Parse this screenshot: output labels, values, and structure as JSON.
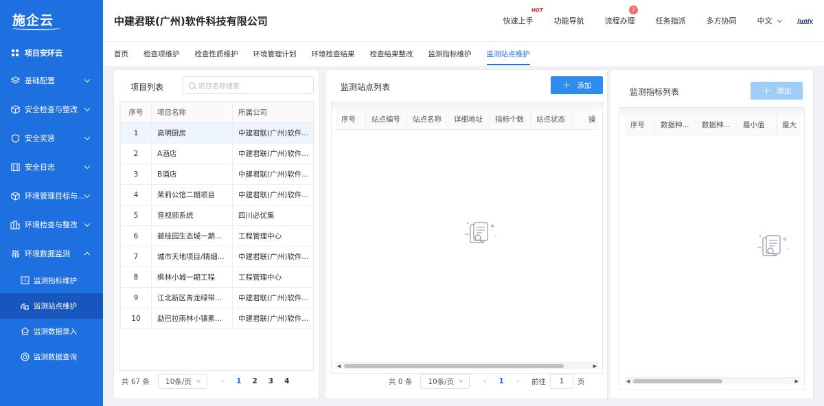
{
  "sidebar": {
    "logo": "施企云",
    "project": "项目安环云",
    "items": [
      {
        "label": "基础配置"
      },
      {
        "label": "安全检查与整改"
      },
      {
        "label": "安全奖惩"
      },
      {
        "label": "安全日志"
      },
      {
        "label": "环境管理目标与..."
      },
      {
        "label": "环境检查与整改"
      },
      {
        "label": "环境数据监测"
      }
    ],
    "sub_items": [
      {
        "label": "监测指标维护"
      },
      {
        "label": "监测站点维护"
      },
      {
        "label": "监测数据录入"
      },
      {
        "label": "监测数据查询"
      }
    ]
  },
  "header": {
    "company": "中建君联(广州)软件科技有限公司",
    "nav": {
      "quick_start": "快速上手",
      "hot": "HOT",
      "feature_nav": "功能导航",
      "process": "流程办理",
      "process_badge": "7",
      "task": "任务指派",
      "collab": "多方协同",
      "lang": "中文",
      "brand": "Juniy"
    }
  },
  "tabs": [
    "首页",
    "检查项维护",
    "检查性质维护",
    "环境管理计划",
    "环境检查结果",
    "检查结果整改",
    "监测指标维护",
    "监测站点维护"
  ],
  "project_panel": {
    "title": "项目列表",
    "search_placeholder": "项目名称搜索",
    "columns": [
      "序号",
      "项目名称",
      "所属公司"
    ],
    "rows": [
      [
        "1",
        "高明厨房",
        "中建君联(广州)软件..."
      ],
      [
        "2",
        "A酒店",
        "中建君联(广州)软件..."
      ],
      [
        "3",
        "B酒店",
        "中建君联(广州)软件..."
      ],
      [
        "4",
        "茉莉公馆二期项目",
        "中建君联(广州)软件..."
      ],
      [
        "5",
        "音视频系统",
        "四川必优集"
      ],
      [
        "6",
        "碧桂园生态城一期...",
        "工程管理中心"
      ],
      [
        "7",
        "城市天地项目/精细...",
        "中建君联(广州)软件..."
      ],
      [
        "8",
        "枫林小城一期工程",
        "工程管理中心"
      ],
      [
        "9",
        "江北新区青龙绿带...",
        "中建君联(广州)软件..."
      ],
      [
        "10",
        "勐巴拉雨林小镇素...",
        "中建君联(广州)软件..."
      ]
    ],
    "pager": {
      "total": "共 67 条",
      "size": "10条/页",
      "pages": [
        "1",
        "2",
        "3",
        "4"
      ]
    }
  },
  "site_panel": {
    "title": "监测站点列表",
    "add_label": "添加",
    "columns": [
      "序号",
      "站点编号",
      "站点名称",
      "详细地址",
      "指标个数",
      "站点状态",
      "操"
    ],
    "pager": {
      "total": "共 0 条",
      "size": "10条/页",
      "page": "1",
      "goto_label": "前往",
      "goto_value": "1",
      "page_suffix": "页"
    }
  },
  "indicator_panel": {
    "title": "监测指标列表",
    "add_label": "添加",
    "columns": [
      "序号",
      "数据种...",
      "数据种...",
      "最小值",
      "最大"
    ]
  },
  "colors": {
    "primary": "#1e6fe0",
    "sidebar_active": "#1756bd",
    "badge": "#f56c6c"
  }
}
